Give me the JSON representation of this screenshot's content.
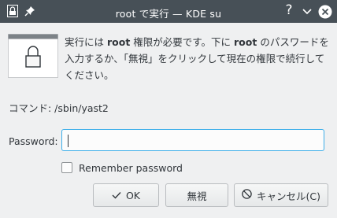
{
  "window": {
    "title": "root で実行 — KDE su",
    "help_glyph": "?"
  },
  "message": {
    "part1": "実行には ",
    "bold1": "root",
    "part2": " 権限が必要です。下に ",
    "bold2": "root",
    "part3": " のパスワードを入力するか、「無視」をクリックして現在の権限で続行してください。"
  },
  "command": {
    "text": "コマンド: /sbin/yast2"
  },
  "password": {
    "label": "Password:",
    "value": ""
  },
  "remember": {
    "label": "Remember password",
    "checked": false
  },
  "buttons": {
    "ok": "OK",
    "ignore": "無視",
    "cancel": "キャンセル(C)"
  },
  "colors": {
    "titlebar": "#475057",
    "focus": "#3daee9",
    "background": "#eff0f1"
  }
}
